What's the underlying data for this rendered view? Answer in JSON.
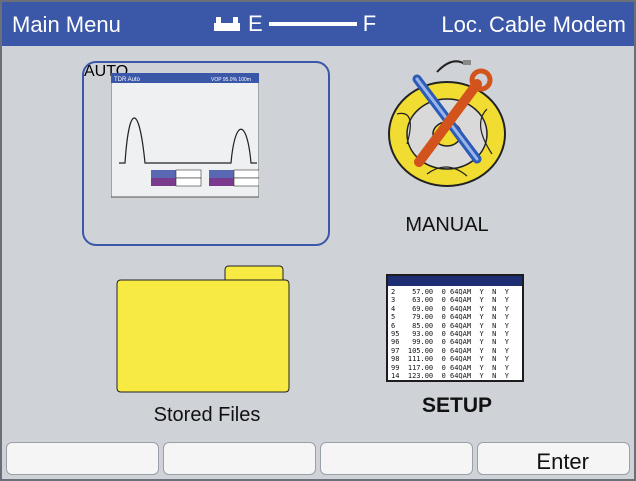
{
  "header": {
    "title": "Main  Menu",
    "fuel_empty": "E",
    "fuel_full": "F",
    "status": "Loc. Cable Modem"
  },
  "tiles": {
    "auto_label": "AUTO",
    "manual_label": "MANUAL",
    "stored_files_label": "Stored Files",
    "setup_label": "SETUP"
  },
  "auto_preview": {
    "title": "TDR Auto",
    "info": "VOP 95.0%  100m"
  },
  "setup_table_rows": [
    "2    57.00  0 64QAM  Y  N  Y",
    "3    63.00  0 64QAM  Y  N  Y",
    "4    69.00  0 64QAM  Y  N  Y",
    "5    79.00  0 64QAM  Y  N  Y",
    "6    85.00  0 64QAM  Y  N  Y",
    "95   93.00  0 64QAM  Y  N  Y",
    "96   99.00  0 64QAM  Y  N  Y",
    "97  105.00  0 64QAM  Y  N  Y",
    "98  111.00  0 64QAM  Y  N  Y",
    "99  117.00  0 64QAM  Y  N  Y",
    "14  123.00  0 64QAM  Y  N  Y"
  ],
  "softkeys": [
    "",
    "",
    "",
    "Enter"
  ],
  "colors": {
    "title_bar": "#3b57a8",
    "folder": "#f6ea43",
    "selection": "#3b57a8"
  }
}
